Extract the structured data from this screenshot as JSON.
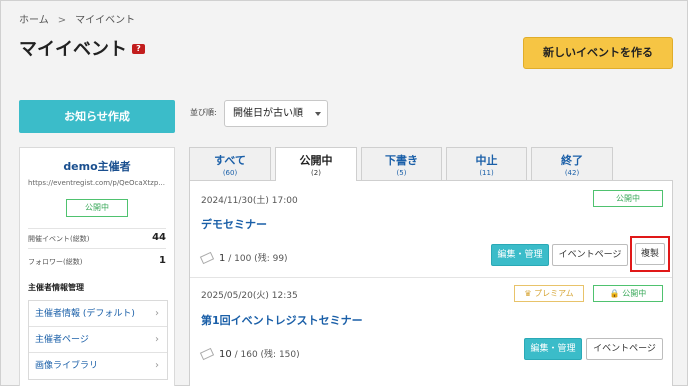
{
  "breadcrumb": {
    "home": "ホーム",
    "separator": ">",
    "current": "マイイベント"
  },
  "page": {
    "title": "マイイベント",
    "help_badge": "?"
  },
  "header": {
    "new_event_label": "新しいイベントを作る"
  },
  "actions": {
    "notice_label": "お知らせ作成"
  },
  "sort": {
    "label": "並び順:",
    "selected": "開催日が古い順"
  },
  "organizer": {
    "name": "demo主催者",
    "url": "https://eventregist.com/p/QeOcaXtzp...",
    "status": "公開中",
    "stats": [
      {
        "label": "開催イベント(総数)",
        "value": "44"
      },
      {
        "label": "フォロワー(総数)",
        "value": "1"
      }
    ],
    "section_title": "主催者情報管理",
    "menu": [
      "主催者情報 (デフォルト)",
      "主催者ページ",
      "画像ライブラリ"
    ]
  },
  "tabs": [
    {
      "label": "すべて",
      "count": "(60)"
    },
    {
      "label": "公開中",
      "count": "(2)",
      "active": true
    },
    {
      "label": "下書き",
      "count": "(5)"
    },
    {
      "label": "中止",
      "count": "(11)"
    },
    {
      "label": "終了",
      "count": "(42)"
    }
  ],
  "events": [
    {
      "date": "2024/11/30(土) 17:00",
      "title": "デモセミナー",
      "status": "公開中",
      "ticket_sold": "1",
      "ticket_rest": "/ 100 (残: 99)",
      "buttons": {
        "edit": "編集・管理",
        "page": "イベントページ",
        "duplicate": "複製"
      }
    },
    {
      "date": "2025/05/20(火) 12:35",
      "title": "第1回イベントレジストセミナー",
      "premium": "プレミアム",
      "status": "公開中",
      "ticket_sold": "10",
      "ticket_rest": "/ 160 (残: 150)",
      "buttons": {
        "edit": "編集・管理",
        "page": "イベントページ"
      }
    }
  ],
  "icons": {
    "crown": "crown-icon",
    "lock": "lock-icon",
    "ticket": "ticket-icon",
    "chevron": "chevron-right-icon"
  },
  "colors": {
    "accent_teal": "#3bbcc9",
    "cta_yellow": "#f6c544",
    "link_blue": "#1a5fa8",
    "status_green": "#3aa95a",
    "highlight_red": "#e01818"
  }
}
